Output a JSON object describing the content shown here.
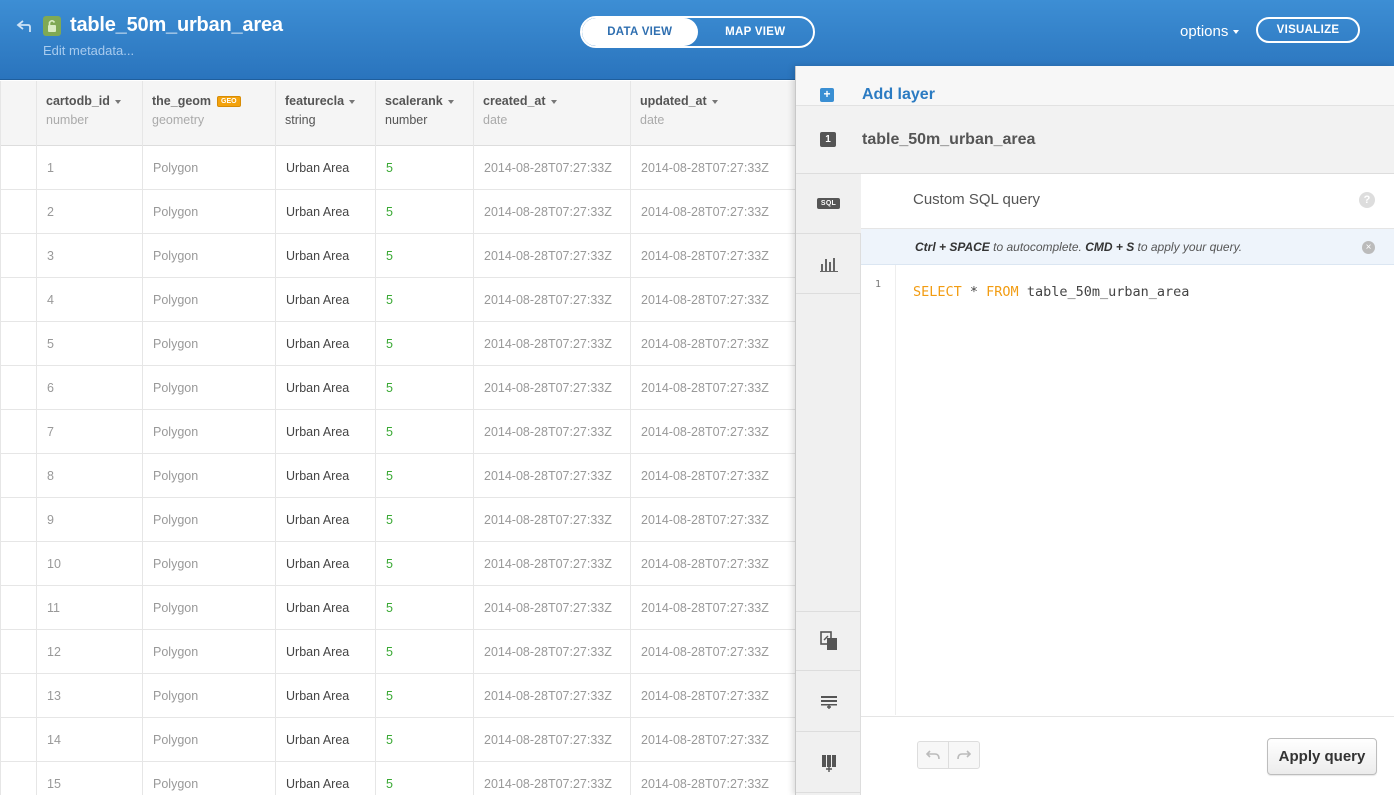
{
  "header": {
    "title": "table_50m_urban_area",
    "edit_metadata": "Edit metadata...",
    "view_tabs": [
      {
        "label": "DATA VIEW",
        "active": true
      },
      {
        "label": "MAP VIEW",
        "active": false
      }
    ],
    "options_label": "options",
    "visualize_label": "VISUALIZE"
  },
  "table": {
    "columns": [
      {
        "name": "cartodb_id",
        "type": "number"
      },
      {
        "name": "the_geom",
        "type": "geometry",
        "badge": "GEO"
      },
      {
        "name": "featurecla",
        "type": "string"
      },
      {
        "name": "scalerank",
        "type": "number"
      },
      {
        "name": "created_at",
        "type": "date"
      },
      {
        "name": "updated_at",
        "type": "date"
      }
    ],
    "rows": [
      [
        "1",
        "Polygon",
        "Urban Area",
        "5",
        "2014-08-28T07:27:33Z",
        "2014-08-28T07:27:33Z"
      ],
      [
        "2",
        "Polygon",
        "Urban Area",
        "5",
        "2014-08-28T07:27:33Z",
        "2014-08-28T07:27:33Z"
      ],
      [
        "3",
        "Polygon",
        "Urban Area",
        "5",
        "2014-08-28T07:27:33Z",
        "2014-08-28T07:27:33Z"
      ],
      [
        "4",
        "Polygon",
        "Urban Area",
        "5",
        "2014-08-28T07:27:33Z",
        "2014-08-28T07:27:33Z"
      ],
      [
        "5",
        "Polygon",
        "Urban Area",
        "5",
        "2014-08-28T07:27:33Z",
        "2014-08-28T07:27:33Z"
      ],
      [
        "6",
        "Polygon",
        "Urban Area",
        "5",
        "2014-08-28T07:27:33Z",
        "2014-08-28T07:27:33Z"
      ],
      [
        "7",
        "Polygon",
        "Urban Area",
        "5",
        "2014-08-28T07:27:33Z",
        "2014-08-28T07:27:33Z"
      ],
      [
        "8",
        "Polygon",
        "Urban Area",
        "5",
        "2014-08-28T07:27:33Z",
        "2014-08-28T07:27:33Z"
      ],
      [
        "9",
        "Polygon",
        "Urban Area",
        "5",
        "2014-08-28T07:27:33Z",
        "2014-08-28T07:27:33Z"
      ],
      [
        "10",
        "Polygon",
        "Urban Area",
        "5",
        "2014-08-28T07:27:33Z",
        "2014-08-28T07:27:33Z"
      ],
      [
        "11",
        "Polygon",
        "Urban Area",
        "5",
        "2014-08-28T07:27:33Z",
        "2014-08-28T07:27:33Z"
      ],
      [
        "12",
        "Polygon",
        "Urban Area",
        "5",
        "2014-08-28T07:27:33Z",
        "2014-08-28T07:27:33Z"
      ],
      [
        "13",
        "Polygon",
        "Urban Area",
        "5",
        "2014-08-28T07:27:33Z",
        "2014-08-28T07:27:33Z"
      ],
      [
        "14",
        "Polygon",
        "Urban Area",
        "5",
        "2014-08-28T07:27:33Z",
        "2014-08-28T07:27:33Z"
      ],
      [
        "15",
        "Polygon",
        "Urban Area",
        "5",
        "2014-08-28T07:27:33Z",
        "2014-08-28T07:27:33Z"
      ]
    ]
  },
  "panel": {
    "add_layer_icon": "+",
    "add_layer_label": "Add layer",
    "layer_number": "1",
    "layer_name": "table_50m_urban_area",
    "side_tabs": [
      {
        "icon": "sql-icon",
        "label": "SQL"
      },
      {
        "icon": "bar-chart-icon"
      },
      {
        "icon": "merge-tables-icon"
      },
      {
        "icon": "add-row-icon"
      },
      {
        "icon": "add-column-icon"
      }
    ],
    "sql": {
      "title": "Custom SQL query",
      "help_icon": "?",
      "tip_key1": "Ctrl + SPACE",
      "tip_text1": " to autocomplete. ",
      "tip_key2": "CMD + S",
      "tip_text2": " to apply your query.",
      "tip_close": "×",
      "line_number": "1",
      "code_kw1": "SELECT",
      "code_mid": " * ",
      "code_kw2": "FROM",
      "code_rest": " table_50m_urban_area",
      "apply_label": "Apply query"
    }
  },
  "colors": {
    "header_blue": "#2f7fc8",
    "accent_blue": "#2b7bc2",
    "geo_badge": "#f3a20c",
    "scalerank_green": "#3aa934",
    "sql_keyword": "#f29c12"
  }
}
